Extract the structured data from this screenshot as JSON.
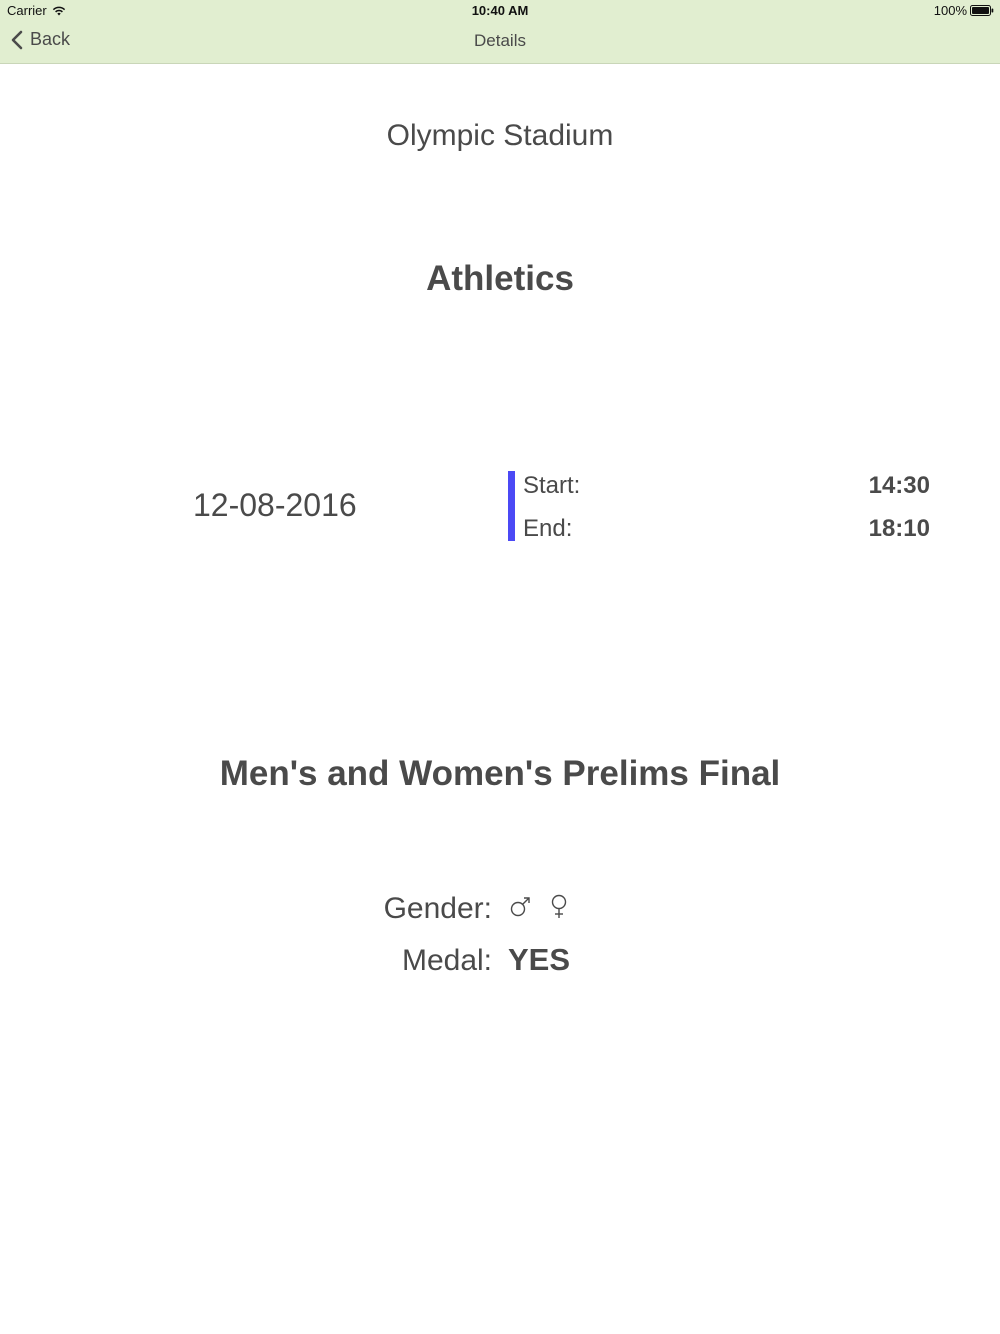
{
  "status_bar": {
    "carrier": "Carrier",
    "time": "10:40 AM",
    "battery": "100%"
  },
  "nav": {
    "back_label": "Back",
    "title": "Details"
  },
  "details": {
    "venue": "Olympic Stadium",
    "sport": "Athletics",
    "date": "12-08-2016",
    "start_label": "Start:",
    "start_time": "14:30",
    "end_label": "End:",
    "end_time": "18:10",
    "event": "Men's and Women's Prelims Final",
    "gender_label": "Gender:",
    "gender_icons": [
      "male-icon",
      "female-icon"
    ],
    "medal_label": "Medal:",
    "medal_value": "YES"
  },
  "colors": {
    "nav_background": "#e1eed0",
    "accent_bar": "#4b49f5",
    "text": "#4a4a4a"
  }
}
